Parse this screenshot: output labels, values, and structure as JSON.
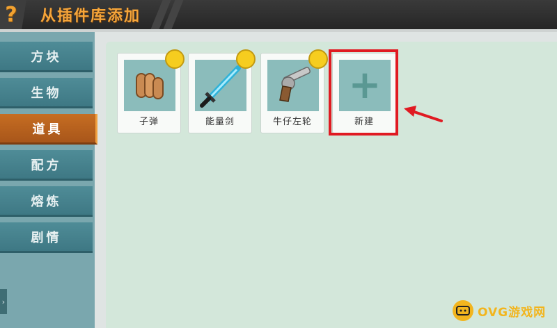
{
  "header": {
    "help_icon": "question-mark",
    "title": "从插件库添加"
  },
  "sidebar": {
    "items": [
      {
        "label": "方块",
        "active": false
      },
      {
        "label": "生物",
        "active": false
      },
      {
        "label": "道具",
        "active": true
      },
      {
        "label": "配方",
        "active": false
      },
      {
        "label": "熔炼",
        "active": false
      },
      {
        "label": "剧情",
        "active": false
      }
    ],
    "expand_icon": "chevron-right"
  },
  "cards": [
    {
      "label": "子弹",
      "icon": "bullets-icon",
      "badge_color": "#f6cd1f"
    },
    {
      "label": "能量剑",
      "icon": "energy-sword-icon",
      "badge_color": "#f6cd1f"
    },
    {
      "label": "牛仔左轮",
      "icon": "revolver-icon",
      "badge_color": "#f6cd1f"
    }
  ],
  "new_card": {
    "label": "新建",
    "icon": "plus-icon"
  },
  "annotation": {
    "highlight_color": "#e01a22"
  },
  "watermark": {
    "text": "OVG游戏网"
  }
}
